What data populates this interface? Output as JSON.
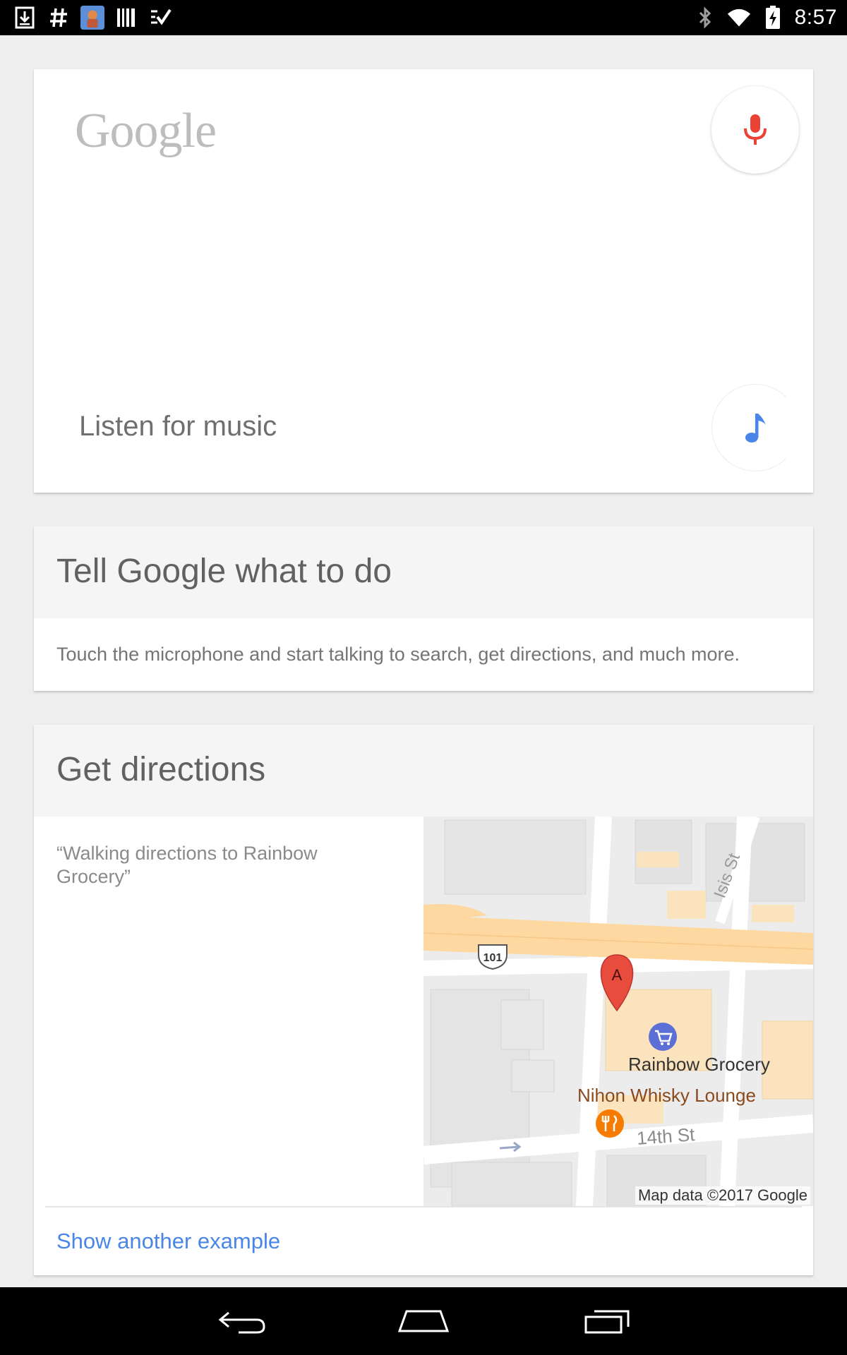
{
  "status_bar": {
    "time": "8:57",
    "left_icons": [
      "download-icon",
      "hash-icon",
      "app-avatar-icon",
      "barcode-icon",
      "tasks-icon"
    ],
    "right_icons": [
      "bluetooth-icon",
      "wifi-icon",
      "battery-charging-icon"
    ]
  },
  "search_card": {
    "logo": "Google",
    "mic_icon": "microphone-icon",
    "listen_label": "Listen for music",
    "music_icon": "music-note-icon"
  },
  "tell_card": {
    "title": "Tell Google what to do",
    "body": "Touch the microphone and start talking to search, get directions, and much more."
  },
  "directions_card": {
    "title": "Get directions",
    "example": "“Walking directions to Rainbow Grocery”",
    "map": {
      "labels": {
        "rainbow": "Rainbow Grocery",
        "nihon": "Nihon Whisky Lounge",
        "street_14th": "14th St",
        "street_isis": "Isis St",
        "highway": "101",
        "pin": "A"
      },
      "attribution": "Map data ©2017 Google"
    },
    "action": "Show another example"
  },
  "colors": {
    "accent_blue": "#4a86e8",
    "mic_red": "#ea4335",
    "highway": "#fdd8a0",
    "background": "#eeeeee"
  },
  "nav_bar": {
    "buttons": [
      "back-icon",
      "home-icon",
      "recents-icon"
    ]
  }
}
